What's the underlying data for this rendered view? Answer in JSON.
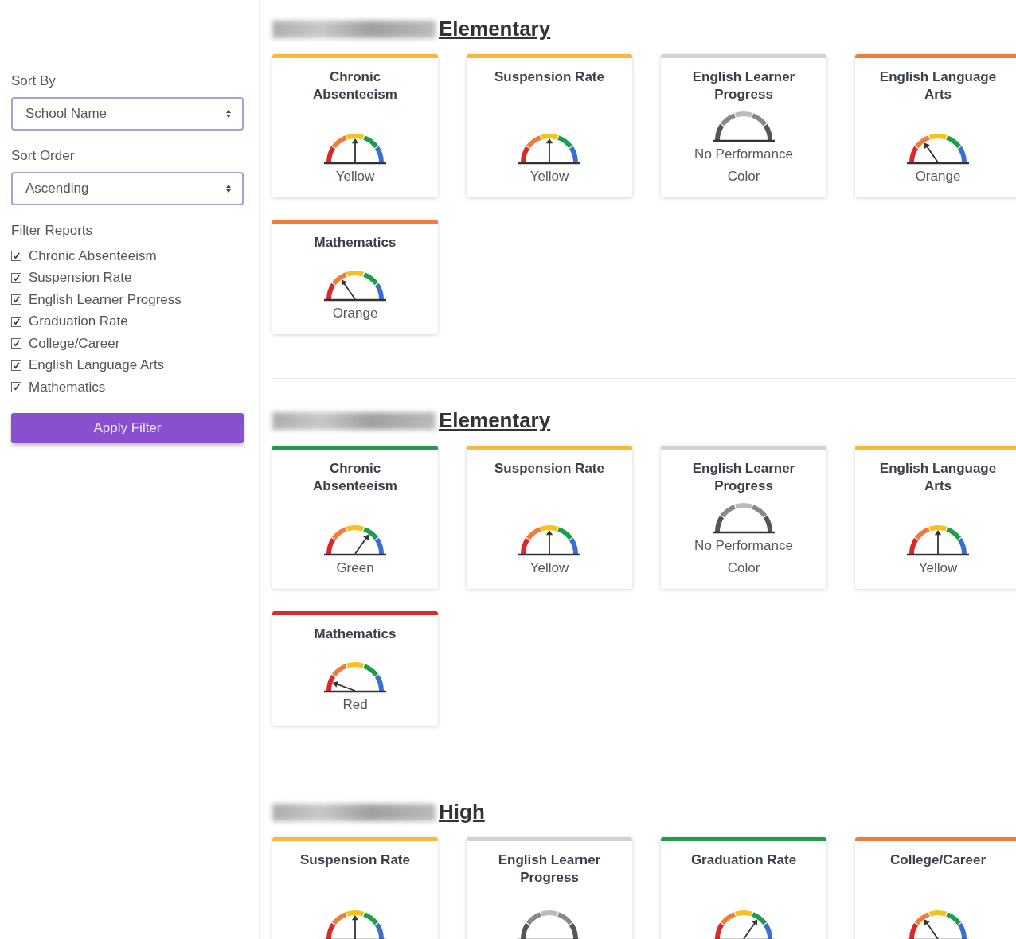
{
  "sidebar": {
    "sort_by": {
      "label": "Sort By",
      "value": "School Name"
    },
    "sort_order": {
      "label": "Sort Order",
      "value": "Ascending"
    },
    "filter": {
      "label": "Filter Reports",
      "items": [
        {
          "label": "Chronic Absenteeism",
          "checked": true
        },
        {
          "label": "Suspension Rate",
          "checked": true
        },
        {
          "label": "English Learner Progress",
          "checked": true
        },
        {
          "label": "Graduation Rate",
          "checked": true
        },
        {
          "label": "College/Career",
          "checked": true
        },
        {
          "label": "English Language Arts",
          "checked": true
        },
        {
          "label": "Mathematics",
          "checked": true
        }
      ]
    },
    "apply_button": "Apply Filter"
  },
  "schools": [
    {
      "name_visible": "Elementary",
      "cards": [
        {
          "title": "Chronic Absenteeism",
          "kind": "yellow",
          "label": "Yellow"
        },
        {
          "title": "Suspension Rate",
          "kind": "yellow",
          "label": "Yellow"
        },
        {
          "title": "English Learner Progress",
          "kind": "none",
          "label": "No Performance Color"
        },
        {
          "title": "English Language Arts",
          "kind": "orange",
          "label": "Orange"
        },
        {
          "title": "Mathematics",
          "kind": "orange",
          "label": "Orange"
        }
      ]
    },
    {
      "name_visible": "Elementary",
      "cards": [
        {
          "title": "Chronic Absenteeism",
          "kind": "green",
          "label": "Green"
        },
        {
          "title": "Suspension Rate",
          "kind": "yellow",
          "label": "Yellow"
        },
        {
          "title": "English Learner Progress",
          "kind": "none",
          "label": "No Performance Color"
        },
        {
          "title": "English Language Arts",
          "kind": "yellow",
          "label": "Yellow"
        },
        {
          "title": "Mathematics",
          "kind": "red",
          "label": "Red"
        }
      ]
    },
    {
      "name_visible": "High",
      "cards": [
        {
          "title": "Suspension Rate",
          "kind": "yellow"
        },
        {
          "title": "English Learner Progress",
          "kind": "none"
        },
        {
          "title": "Graduation Rate",
          "kind": "green"
        },
        {
          "title": "College/Career",
          "kind": "orange"
        }
      ]
    }
  ]
}
